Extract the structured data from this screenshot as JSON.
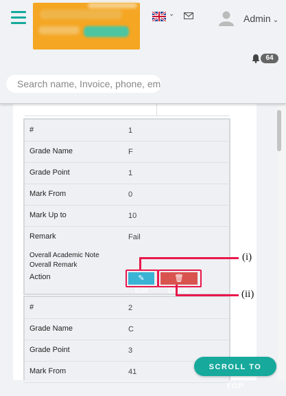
{
  "header": {
    "admin_label": "Admin",
    "notification_count": "64",
    "search_placeholder": "Search name, Invoice, phone, ema"
  },
  "cards": [
    {
      "rows": [
        {
          "key": "#",
          "value": "1"
        },
        {
          "key": "Grade Name",
          "value": "F"
        },
        {
          "key": "Grade Point",
          "value": "1"
        },
        {
          "key": "Mark From",
          "value": "0"
        },
        {
          "key": "Mark Up to",
          "value": "10"
        },
        {
          "key": "Remark",
          "value": "Fail"
        }
      ],
      "note_label": "Overall Academic Note",
      "remark_label": "Overall Remark",
      "action_label": "Action",
      "edit_label": "Edit",
      "delete_label": "Delete"
    },
    {
      "rows": [
        {
          "key": "#",
          "value": "2"
        },
        {
          "key": "Grade Name",
          "value": "C"
        },
        {
          "key": "Grade Point",
          "value": "3"
        },
        {
          "key": "Mark From",
          "value": "41"
        }
      ]
    }
  ],
  "annotations": {
    "edit": "(i)",
    "delete": "(ii)"
  },
  "scroll_top_label": "SCROLL TO TOP",
  "colors": {
    "accent": "#16a99c",
    "edit": "#3ab3d5",
    "delete": "#d9534f",
    "annotation": "#e8174b"
  }
}
